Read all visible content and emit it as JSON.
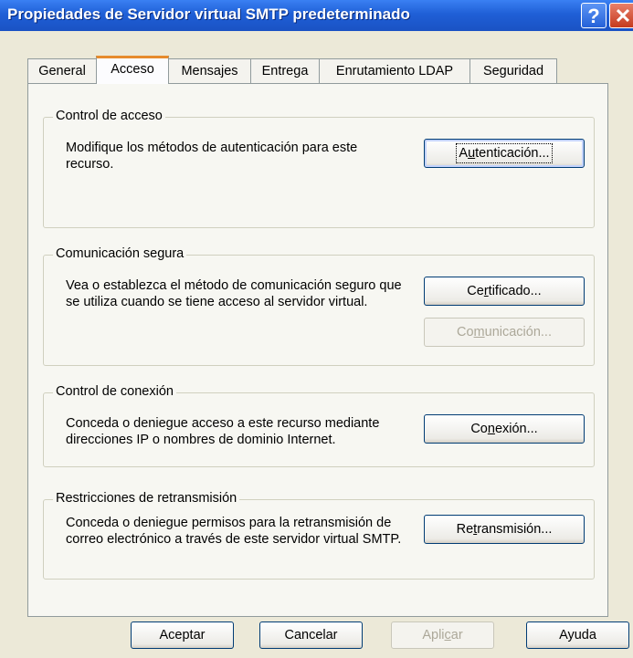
{
  "window": {
    "title": "Propiedades de Servidor virtual SMTP predeterminado",
    "help_glyph": "?",
    "close_glyph": "✕"
  },
  "tabs": [
    {
      "label": "General",
      "active": false
    },
    {
      "label": "Acceso",
      "active": true
    },
    {
      "label": "Mensajes",
      "active": false
    },
    {
      "label": "Entrega",
      "active": false
    },
    {
      "label": "Enrutamiento LDAP",
      "active": false
    },
    {
      "label": "Seguridad",
      "active": false
    }
  ],
  "groups": {
    "access_control": {
      "legend": "Control de acceso",
      "description": "Modifique los métodos de autenticación para este recurso.",
      "button": {
        "pre": "A",
        "accel": "u",
        "post": "tenticación...",
        "enabled": true,
        "focused": true
      }
    },
    "secure_communication": {
      "legend": "Comunicación segura",
      "description": "Vea o establezca el método de comunicación seguro que se utiliza cuando se tiene acceso al servidor virtual.",
      "button1": {
        "pre": "Ce",
        "accel": "r",
        "post": "tificado...",
        "enabled": true
      },
      "button2": {
        "pre": "Co",
        "accel": "m",
        "post": "unicación...",
        "enabled": false
      }
    },
    "connection_control": {
      "legend": "Control de conexión",
      "description": "Conceda o deniegue acceso a este recurso mediante direcciones IP o nombres de dominio Internet.",
      "button": {
        "pre": "Co",
        "accel": "n",
        "post": "exión...",
        "enabled": true
      }
    },
    "relay_restrictions": {
      "legend": "Restricciones de retransmisión",
      "description": "Conceda o deniegue permisos para la retransmisión de correo electrónico a través de este servidor virtual SMTP.",
      "button": {
        "pre": "Re",
        "accel": "t",
        "post": "ransmisión...",
        "enabled": true
      }
    }
  },
  "footer": {
    "ok": "Aceptar",
    "cancel": "Cancelar",
    "apply_pre": "Apli",
    "apply_accel": "c",
    "apply_post": "ar",
    "help": "Ayuda"
  }
}
